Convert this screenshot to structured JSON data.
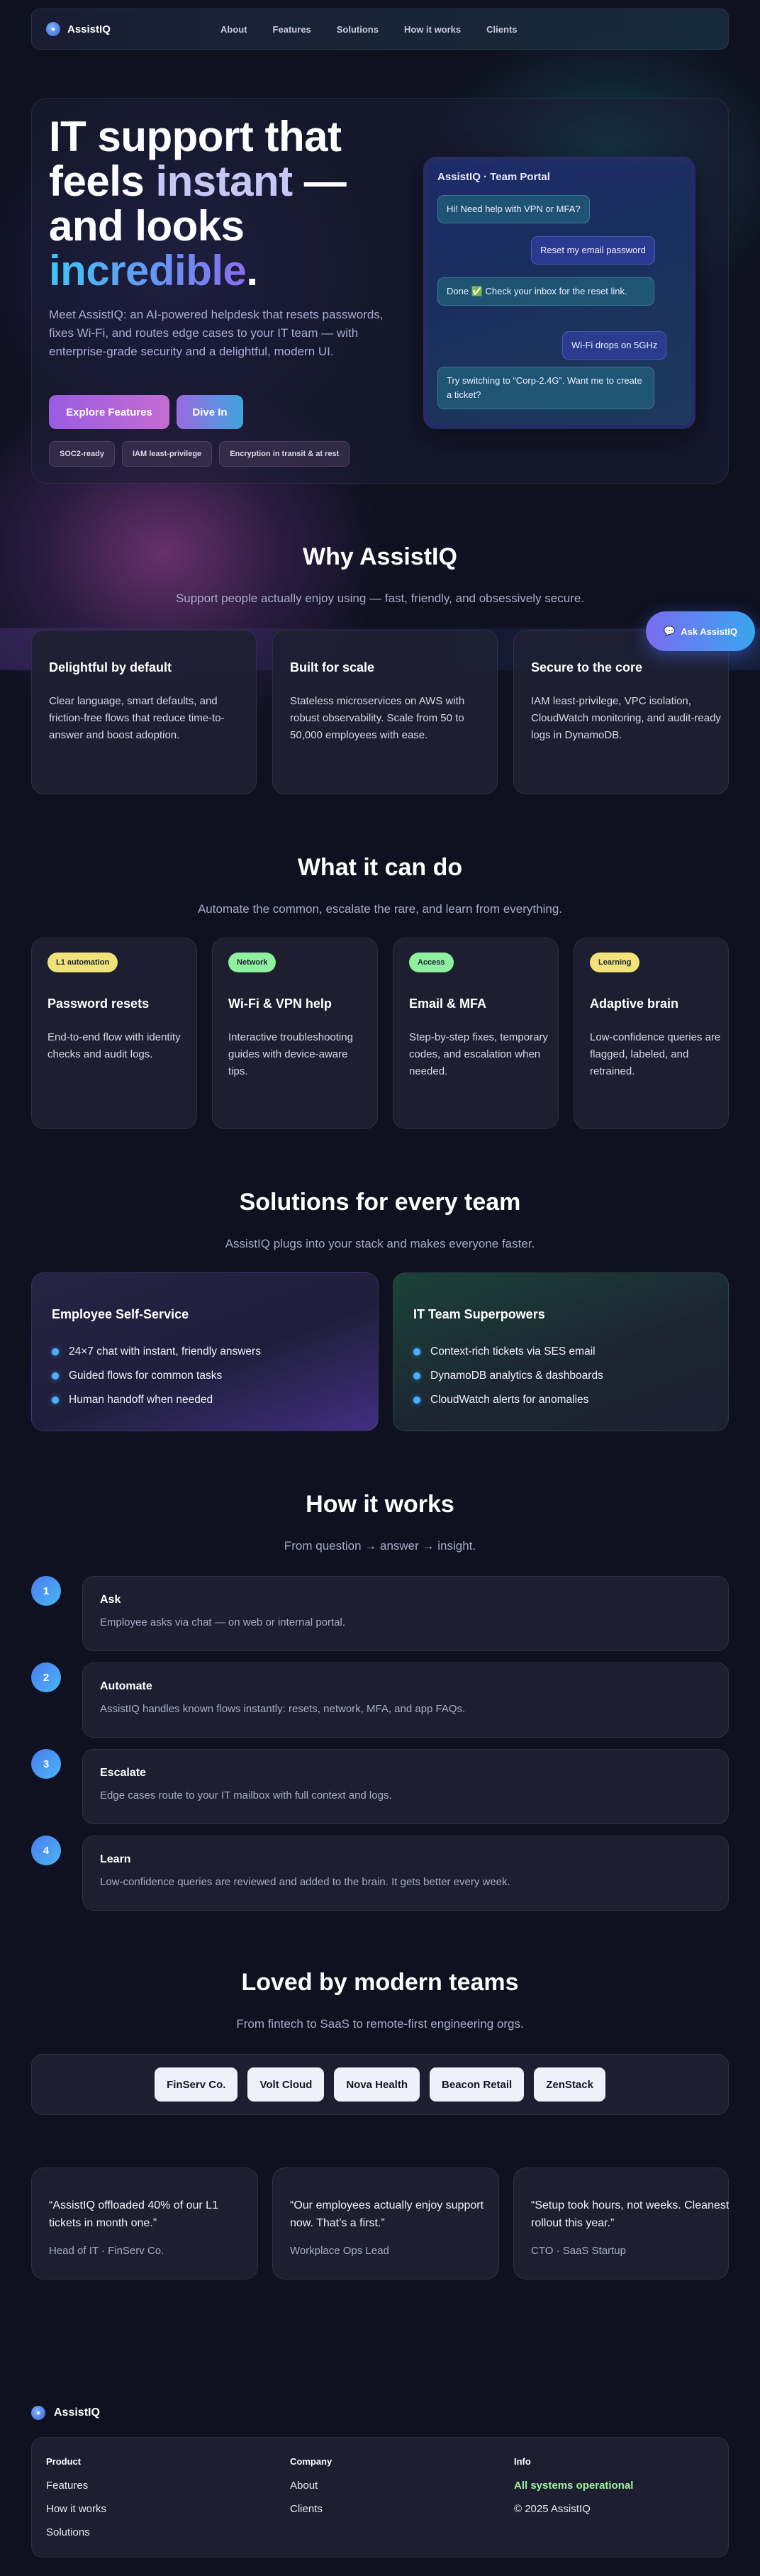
{
  "nav": {
    "brand": "AssistIQ",
    "links": [
      "About",
      "Features",
      "Solutions",
      "How it works",
      "Clients"
    ]
  },
  "hero": {
    "title_line1": "IT support that",
    "title_line2a": "feels ",
    "title_line2b": "instant",
    "title_line2c": " —",
    "title_line3": "and looks",
    "title_line4": "incredible",
    "title_period": ".",
    "subtitle": "Meet AssistIQ: an AI-powered helpdesk that resets passwords, fixes Wi-Fi, and routes edge cases to your IT team — with enterprise-grade security and a delightful, modern UI.",
    "primary_button": "Explore Features",
    "secondary_button": "Dive In",
    "chips": [
      "SOC2-ready",
      "IAM least-privilege",
      "Encryption in transit & at rest"
    ]
  },
  "portal": {
    "title": "AssistIQ · Team Portal",
    "messages": [
      {
        "role": "bot",
        "text": "Hi! Need help with VPN or MFA?"
      },
      {
        "role": "user",
        "text": "Reset my email password"
      },
      {
        "role": "bot",
        "text": "Done ✅ Check your inbox for the reset link."
      },
      {
        "role": "user",
        "text": "Wi-Fi drops on 5GHz"
      },
      {
        "role": "bot",
        "text": "Try switching to “Corp-2.4G”. Want me to create a ticket?"
      }
    ]
  },
  "ask_button": {
    "label": "Ask AssistIQ",
    "icon": "chat-bubble-icon"
  },
  "why": {
    "title": "Why AssistIQ",
    "subtitle": "Support people actually enjoy using — fast, friendly, and obsessively secure.",
    "cards": [
      {
        "title": "Delightful by default",
        "text": "Clear language, smart defaults, and friction-free flows that reduce time-to-answer and boost adoption."
      },
      {
        "title": "Built for scale",
        "text": "Stateless microservices on AWS with robust observability. Scale from 50 to 50,000 employees with ease."
      },
      {
        "title": "Secure to the core",
        "text": "IAM least-privilege, VPC isolation, CloudWatch monitoring, and audit-ready logs in DynamoDB."
      }
    ]
  },
  "features": {
    "title": "What it can do",
    "subtitle": "Automate the common, escalate the rare, and learn from everything.",
    "cards": [
      {
        "tag": "L1 automation",
        "title": "Password resets",
        "text": "End-to-end flow with identity checks and audit logs."
      },
      {
        "tag": "Network",
        "title": "Wi-Fi & VPN help",
        "text": "Interactive troubleshooting guides with device-aware tips."
      },
      {
        "tag": "Access",
        "title": "Email & MFA",
        "text": "Step-by-step fixes, temporary codes, and escalation when needed."
      },
      {
        "tag": "Learning",
        "title": "Adaptive brain",
        "text": "Low-confidence queries are flagged, labeled, and retrained."
      }
    ]
  },
  "solutions": {
    "title": "Solutions for every team",
    "subtitle": "AssistIQ plugs into your stack and makes everyone faster.",
    "left": {
      "title": "Employee Self-Service",
      "items": [
        "24×7 chat with instant, friendly answers",
        "Guided flows for common tasks",
        "Human handoff when needed"
      ]
    },
    "right": {
      "title": "IT Team Superpowers",
      "items": [
        "Context-rich tickets via SES email",
        "DynamoDB analytics & dashboards",
        "CloudWatch alerts for anomalies"
      ]
    }
  },
  "how": {
    "title": "How it works",
    "subtitle": "From question → answer → insight.",
    "steps": [
      {
        "num": "1",
        "title": "Ask",
        "text": "Employee asks via chat — on web or internal portal."
      },
      {
        "num": "2",
        "title": "Automate",
        "text": "AssistIQ handles known flows instantly: resets, network, MFA, and app FAQs."
      },
      {
        "num": "3",
        "title": "Escalate",
        "text": "Edge cases route to your IT mailbox with full context and logs."
      },
      {
        "num": "4",
        "title": "Learn",
        "text": "Low-confidence queries are reviewed and added to the brain. It gets better every week."
      }
    ]
  },
  "clients": {
    "title": "Loved by modern teams",
    "subtitle": "From fintech to SaaS to remote-first engineering orgs.",
    "logos": [
      "FinServ Co.",
      "Volt Cloud",
      "Nova Health",
      "Beacon Retail",
      "ZenStack"
    ]
  },
  "testimonials": [
    {
      "quote": "“AssistIQ offloaded 40% of our L1 tickets in month one.”",
      "who": "Head of IT · FinServ Co."
    },
    {
      "quote": "“Our employees actually enjoy support now. That’s a first.”",
      "who": "Workplace Ops Lead"
    },
    {
      "quote": "“Setup took hours, not weeks. Cleanest rollout this year.”",
      "who": "CTO · SaaS Startup"
    }
  ],
  "footer": {
    "brand": "AssistIQ",
    "product": {
      "heading": "Product",
      "links": [
        "Features",
        "How it works",
        "Solutions"
      ]
    },
    "company": {
      "heading": "Company",
      "links": [
        "About",
        "Clients"
      ]
    },
    "info": {
      "heading": "Info",
      "status": "All systems operational",
      "copyright": "© 2025 AssistIQ"
    }
  },
  "colors": {
    "accent_purple": "#9a5ce0",
    "accent_blue": "#3fa5e0",
    "tag_yellow": "#f2e27a",
    "tag_green": "#8ff0a0",
    "status_green": "#9df0a0"
  }
}
